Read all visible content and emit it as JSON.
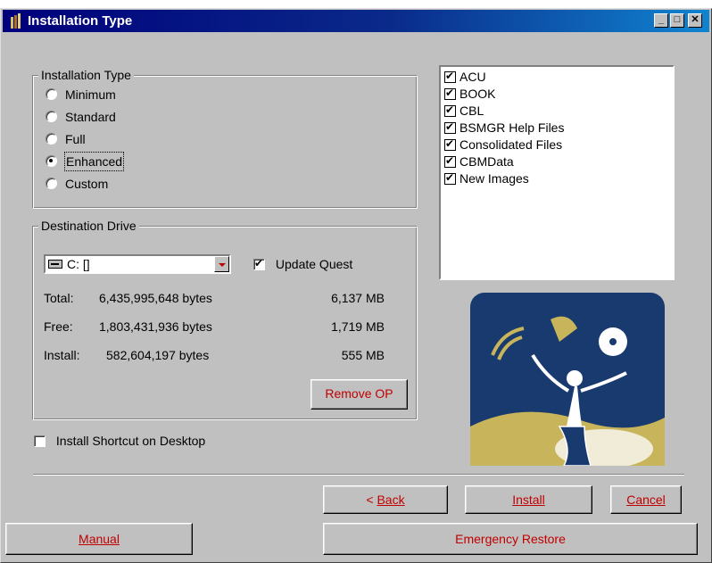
{
  "window": {
    "title": "Installation Type"
  },
  "title_controls": {
    "minimize": "_",
    "maximize": "□",
    "close": "✕"
  },
  "install_type": {
    "legend": "Installation Type",
    "options": [
      "Minimum",
      "Standard",
      "Full",
      "Enhanced",
      "Custom"
    ],
    "selected": "Enhanced"
  },
  "components": {
    "items": [
      {
        "label": "ACU",
        "checked": true
      },
      {
        "label": "BOOK",
        "checked": true
      },
      {
        "label": "CBL",
        "checked": true
      },
      {
        "label": "BSMGR Help Files",
        "checked": true
      },
      {
        "label": "Consolidated Files",
        "checked": true
      },
      {
        "label": "CBMData",
        "checked": true
      },
      {
        "label": "New Images",
        "checked": true
      }
    ]
  },
  "destination": {
    "legend": "Destination Drive",
    "drive": "C: []",
    "update_quest_label": "Update Quest",
    "update_quest_checked": true,
    "total_label": "Total:",
    "total_bytes": "6,435,995,648 bytes",
    "total_mb": "6,137 MB",
    "free_label": "Free:",
    "free_bytes": "1,803,431,936 bytes",
    "free_mb": "1,719 MB",
    "install_label": "Install:",
    "install_bytes": "582,604,197 bytes",
    "install_mb": "555 MB",
    "remove_op": "Remove OP"
  },
  "shortcut": {
    "label": "Install Shortcut on Desktop",
    "checked": false
  },
  "buttons": {
    "back_prefix": "< ",
    "back_label": "Back",
    "install": "Install",
    "cancel": "Cancel",
    "manual": "Manual",
    "emergency_restore": "Emergency Restore"
  },
  "colors": {
    "button_text": "#c00000",
    "titlebar_start": "#00007b",
    "titlebar_end": "#1084d0",
    "face": "#c0c0c0",
    "illustration_bg": "#183a6e",
    "illustration_gold": "#c8b45a"
  }
}
